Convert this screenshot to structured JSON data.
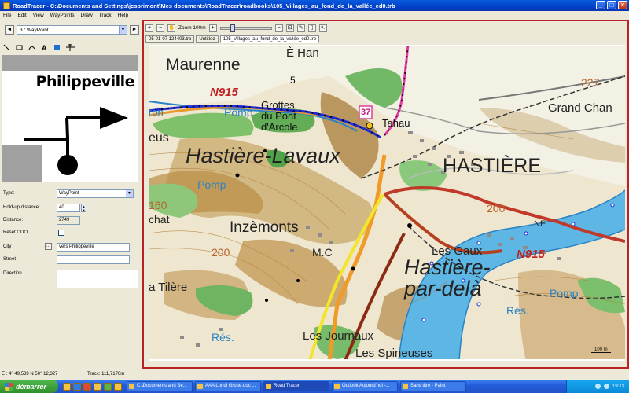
{
  "window": {
    "title": "RoadTracer - C:\\Documents and Settings\\jcsprimont\\Mes documents\\RoadTracer\\roadbooks\\105_Villages_au_fond_de_la_vallée_ed0.trb",
    "minimize": "_",
    "maximize": "□",
    "close": "×"
  },
  "menu": [
    "File",
    "Edit",
    "View",
    "WayPoints",
    "Draw",
    "Track",
    "Help"
  ],
  "waypoint_nav": {
    "prev": "◄",
    "selected": "37 WayPoint",
    "next": "►"
  },
  "sketch": {
    "town": "Philippeville"
  },
  "properties": {
    "type_label": "Type:",
    "type_value": "WayPoint",
    "holdup_label": "Hold-up distance:",
    "holdup_value": "40",
    "distance_label": "Distance:",
    "distance_value": "2749",
    "reset_label": "Reset ODO",
    "city_label": "City",
    "city_value": "vers Philippeville",
    "street_label": "Street",
    "street_value": "",
    "direction_label": "Direction",
    "direction_value": "",
    "dots": "..."
  },
  "map_toolbar": {
    "zoom": "Zoom 100m"
  },
  "tabs": [
    "05-01-07 124403.trb",
    "Untitled",
    "105_Villages_au_fond_de_la_vallée_ed0.trb"
  ],
  "map": {
    "labels": {
      "ehan": "È Han",
      "maurenne": "Maurenne",
      "n915a": "N915",
      "n915b": "N915",
      "pomp1": "Pomp",
      "pomp2": "Pomp",
      "pomp3": "Pomp",
      "grottes1": "Grottes",
      "grottes2": "du Pont",
      "grottes3": "d'Arcole",
      "tahau": "Tahau",
      "hastiere_lavaux": "Hastière-Lavaux",
      "hastiere": "HASTIÈRE",
      "n227": "227",
      "grandchan": "Grand Chan",
      "inzemonts": "Inzèmonts",
      "lesgaux": "Les Gaux",
      "hpd1": "Hastière-",
      "hpd2": "par-delà",
      "mc": "M.C",
      "tilere": "a Tilère",
      "res1": "Rés.",
      "res2": "Rés.",
      "lesjournaux": "Les Journaux",
      "lesspineuses": "Les Spineuses",
      "ne": "NE",
      "n200a": "200",
      "n200b": "200",
      "n160": "160",
      "eus": "eus",
      "chat": "chat",
      "ron": "ron",
      "five": "5",
      "badge": "37",
      "scale": "100 m"
    }
  },
  "status": {
    "coords": "E : 4° 49,539 N 50° 12,327",
    "track": "Track: 111,7176m"
  },
  "taskbar": {
    "start": "démarrer",
    "tasks": [
      "C:\\Documents and Se...",
      "AAA Lundi Grotte.doc ...",
      "Road Tracer",
      "Outlook Aujourd'hui -...",
      "Sans titre - Paint"
    ],
    "clock": "19:13"
  }
}
